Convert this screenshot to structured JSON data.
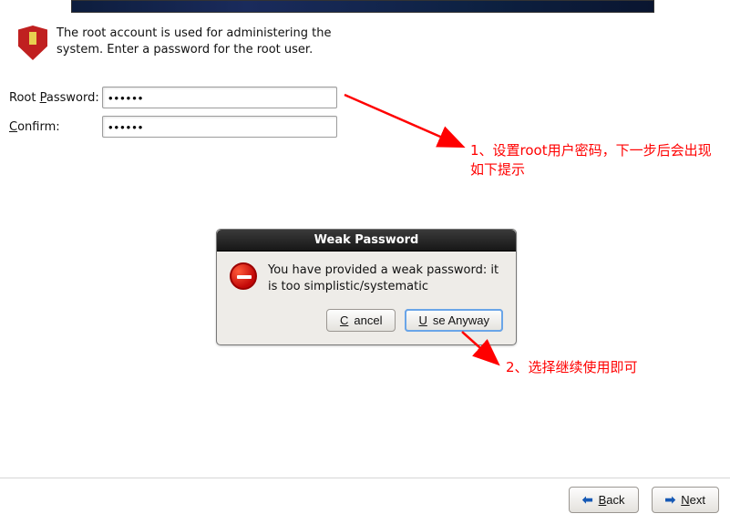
{
  "instruction": "The root account is used for administering the system.  Enter a password for the root user.",
  "form": {
    "root_label_pre": "Root ",
    "root_label_ul": "P",
    "root_label_post": "assword:",
    "confirm_label_ul": "C",
    "confirm_label_post": "onfirm:",
    "root_value": "••••••",
    "confirm_value": "••••••"
  },
  "annotations": {
    "a1": "1、设置root用户密码，下一步后会出现如下提示",
    "a2": "2、选择继续使用即可"
  },
  "dialog": {
    "title": "Weak Password",
    "message": "You have provided a weak password: it is too simplistic/systematic",
    "cancel_ul": "C",
    "cancel_post": "ancel",
    "use_ul": "U",
    "use_post": "se Anyway"
  },
  "footer": {
    "back_ul": "B",
    "back_post": "ack",
    "next_ul": "N",
    "next_post": "ext",
    "left_arrow": "⬅",
    "right_arrow": "➡"
  }
}
